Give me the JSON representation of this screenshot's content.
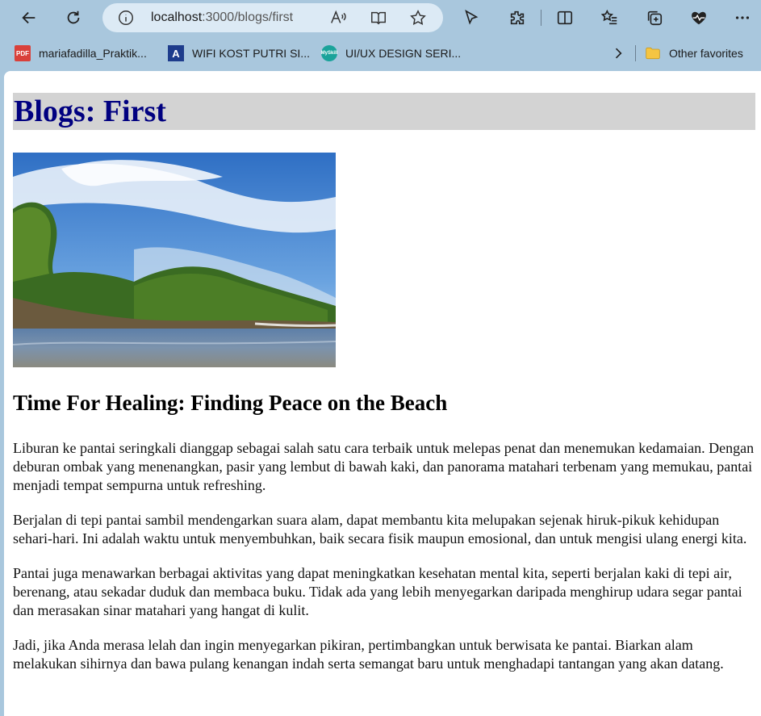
{
  "browser": {
    "url_host": "localhost",
    "url_path": ":3000/blogs/first",
    "icons": [
      "back-icon",
      "refresh-icon",
      "info-icon",
      "read-aloud-icon",
      "immersive-reader-icon",
      "favorite-star-icon",
      "cursor-icon",
      "extensions-icon",
      "split-screen-icon",
      "favorites-list-icon",
      "collections-icon",
      "health-icon",
      "more-icon"
    ]
  },
  "bookmarks": {
    "items": [
      {
        "label": "mariafadilla_Praktik...",
        "icon": "pdf-icon"
      },
      {
        "label": "WIFI KOST PUTRI SI...",
        "icon": "letter-a-icon"
      },
      {
        "label": "UI/UX DESIGN SERI...",
        "icon": "myskill-icon"
      }
    ],
    "other_label": "Other favorites"
  },
  "page": {
    "title": "Blogs: First",
    "post_title": "Time For Healing: Finding Peace on the Beach",
    "paragraphs": [
      "Liburan ke pantai seringkali dianggap sebagai salah satu cara terbaik untuk melepas penat dan menemukan kedamaian. Dengan deburan ombak yang menenangkan, pasir yang lembut di bawah kaki, dan panorama matahari terbenam yang memukau, pantai menjadi tempat sempurna untuk refreshing.",
      "Berjalan di tepi pantai sambil mendengarkan suara alam, dapat membantu kita melupakan sejenak hiruk-pikuk kehidupan sehari-hari. Ini adalah waktu untuk menyembuhkan, baik secara fisik maupun emosional, dan untuk mengisi ulang energi kita.",
      "Pantai juga menawarkan berbagai aktivitas yang dapat meningkatkan kesehatan mental kita, seperti berjalan kaki di tepi air, berenang, atau sekadar duduk dan membaca buku. Tidak ada yang lebih menyegarkan daripada menghirup udara segar pantai dan merasakan sinar matahari yang hangat di kulit.",
      "Jadi, jika Anda merasa lelah dan ingin menyegarkan pikiran, pertimbangkan untuk berwisata ke pantai. Biarkan alam melakukan sihirnya dan bawa pulang kenangan indah serta semangat baru untuk menghadapi tantangan yang akan datang."
    ]
  },
  "colors": {
    "chrome_bg": "#a9c7dd",
    "title_bar_bg": "#d3d3d3",
    "title_text": "#000080"
  }
}
